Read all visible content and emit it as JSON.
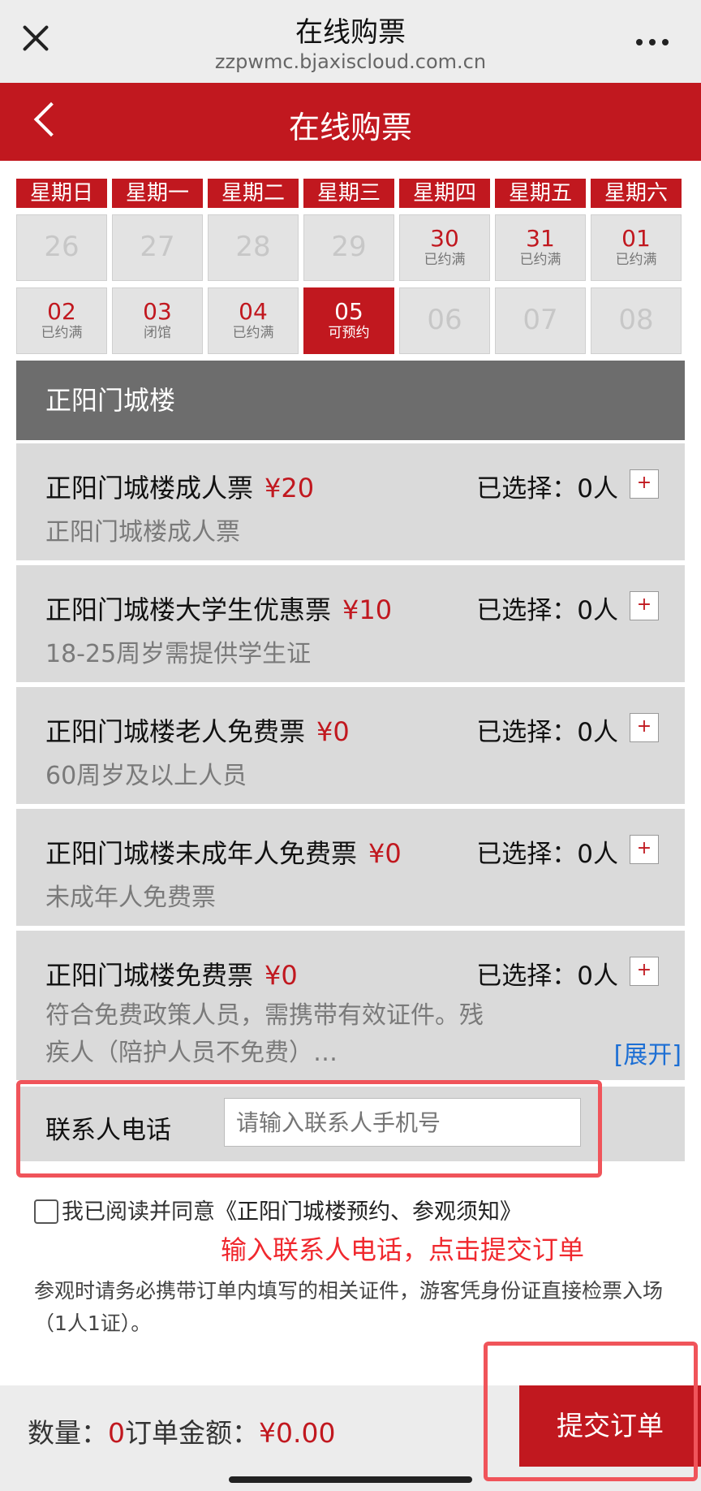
{
  "browser": {
    "title": "在线购票",
    "url": "zzpwmc.bjaxiscloud.com.cn"
  },
  "header": {
    "title": "在线购票"
  },
  "calendar": {
    "weekdays": [
      "星期日",
      "星期一",
      "星期二",
      "星期三",
      "星期四",
      "星期五",
      "星期六"
    ],
    "week1": [
      {
        "day": "26",
        "status": ""
      },
      {
        "day": "27",
        "status": ""
      },
      {
        "day": "28",
        "status": ""
      },
      {
        "day": "29",
        "status": ""
      },
      {
        "day": "30",
        "status": "已约满"
      },
      {
        "day": "31",
        "status": "已约满"
      },
      {
        "day": "01",
        "status": "已约满"
      }
    ],
    "week2": [
      {
        "day": "02",
        "status": "已约满"
      },
      {
        "day": "03",
        "status": "闭馆"
      },
      {
        "day": "04",
        "status": "已约满"
      },
      {
        "day": "05",
        "status": "可预约"
      },
      {
        "day": "06",
        "status": ""
      },
      {
        "day": "07",
        "status": ""
      },
      {
        "day": "08",
        "status": ""
      }
    ]
  },
  "venue": {
    "name": "正阳门城楼"
  },
  "tickets": [
    {
      "name": "正阳门城楼成人票",
      "price": "¥20",
      "desc": "正阳门城楼成人票",
      "selected": "已选择：0人",
      "plus": "+"
    },
    {
      "name": "正阳门城楼大学生优惠票",
      "price": "¥10",
      "desc": "18-25周岁需提供学生证",
      "selected": "已选择：0人",
      "plus": "+"
    },
    {
      "name": "正阳门城楼老人免费票",
      "price": "¥0",
      "desc": "60周岁及以上人员",
      "selected": "已选择：0人",
      "plus": "+"
    },
    {
      "name": "正阳门城楼未成年人免费票",
      "price": "¥0",
      "desc": "未成年人免费票",
      "selected": "已选择：0人",
      "plus": "+"
    },
    {
      "name": "正阳门城楼免费票",
      "price": "¥0",
      "desc": "符合免费政策人员，需携带有效证件。残疾人（陪护人员不免费）…",
      "selected": "已选择：0人",
      "plus": "+",
      "expand": "[展开]"
    }
  ],
  "contact": {
    "label": "联系人电话",
    "placeholder": "请输入联系人手机号",
    "value": ""
  },
  "agreement": {
    "text": "我已阅读并同意",
    "link": "《正阳门城楼预约、参观须知》"
  },
  "annotation": "输入联系人电话，点击提交订单",
  "notice": "参观时请务必携带订单内填写的相关证件，游客凭身份证直接检票入场（1人1证）。",
  "footer": {
    "qty_label": "数量：",
    "qty_value": "0",
    "amount_label": "订单金额：",
    "amount_value": "¥0.00",
    "submit": "提交订单"
  },
  "colors": {
    "brand": "#c1181f",
    "highlight": "#f0545a",
    "link": "#1d6fd4"
  }
}
